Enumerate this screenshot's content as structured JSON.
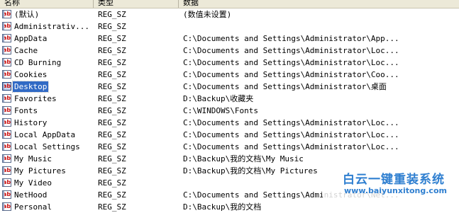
{
  "columns": {
    "name": "名称",
    "type": "类型",
    "data": "数据"
  },
  "icon_glyph": "ab",
  "accent_color": "#316ac5",
  "rows": [
    {
      "name": "(默认)",
      "type": "REG_SZ",
      "data": "(数值未设置)",
      "selected": false
    },
    {
      "name": "Administrativ...",
      "type": "REG_SZ",
      "data": "",
      "selected": false
    },
    {
      "name": "AppData",
      "type": "REG_SZ",
      "data": "C:\\Documents and Settings\\Administrator\\App...",
      "selected": false
    },
    {
      "name": "Cache",
      "type": "REG_SZ",
      "data": "C:\\Documents and Settings\\Administrator\\Loc...",
      "selected": false
    },
    {
      "name": "CD Burning",
      "type": "REG_SZ",
      "data": "C:\\Documents and Settings\\Administrator\\Loc...",
      "selected": false
    },
    {
      "name": "Cookies",
      "type": "REG_SZ",
      "data": "C:\\Documents and Settings\\Administrator\\Coo...",
      "selected": false
    },
    {
      "name": "Desktop",
      "type": "REG_SZ",
      "data": "C:\\Documents and Settings\\Administrator\\桌面",
      "selected": true
    },
    {
      "name": "Favorites",
      "type": "REG_SZ",
      "data": "D:\\Backup\\收藏夹",
      "selected": false
    },
    {
      "name": "Fonts",
      "type": "REG_SZ",
      "data": "C:\\WINDOWS\\Fonts",
      "selected": false
    },
    {
      "name": "History",
      "type": "REG_SZ",
      "data": "C:\\Documents and Settings\\Administrator\\Loc...",
      "selected": false
    },
    {
      "name": "Local AppData",
      "type": "REG_SZ",
      "data": "C:\\Documents and Settings\\Administrator\\Loc...",
      "selected": false
    },
    {
      "name": "Local Settings",
      "type": "REG_SZ",
      "data": "C:\\Documents and Settings\\Administrator\\Loc...",
      "selected": false
    },
    {
      "name": "My Music",
      "type": "REG_SZ",
      "data": "D:\\Backup\\我的文档\\My Music",
      "selected": false
    },
    {
      "name": "My Pictures",
      "type": "REG_SZ",
      "data": "D:\\Backup\\我的文档\\My Pictures",
      "selected": false
    },
    {
      "name": "My Video",
      "type": "REG_SZ",
      "data": "",
      "selected": false
    },
    {
      "name": "NetHood",
      "type": "REG_SZ",
      "data": "C:\\Documents and Settings\\Administrator\\Net...",
      "selected": false
    },
    {
      "name": "Personal",
      "type": "REG_SZ",
      "data": "D:\\Backup\\我的文档",
      "selected": false
    }
  ],
  "watermark": {
    "title": "白云一键重装系统",
    "url": "www.baiyunxitong.com"
  }
}
